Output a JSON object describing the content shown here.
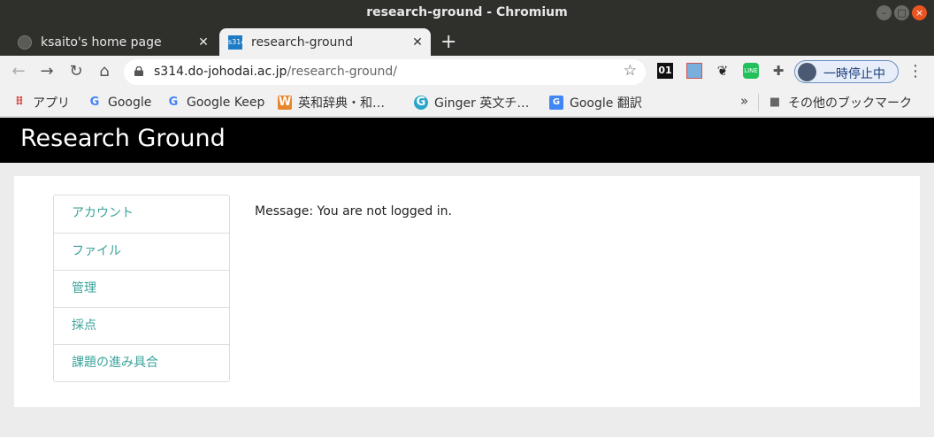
{
  "window": {
    "title": "research-ground - Chromium"
  },
  "tabs": [
    {
      "label": "ksaito's home page",
      "active": false
    },
    {
      "label": "research-ground",
      "active": true
    }
  ],
  "toolbar": {
    "url_host": "s314.do-johodai.ac.jp",
    "url_path": "/research-ground/",
    "profile_label": "一時停止中"
  },
  "bookmarks": [
    {
      "label": "アプリ",
      "icon": "apps-grid-icon"
    },
    {
      "label": "Google",
      "icon": "google-icon"
    },
    {
      "label": "Google Keep",
      "icon": "google-icon"
    },
    {
      "label": "英和辞典・和…",
      "icon": "weblio-icon"
    },
    {
      "label": "Ginger 英文チ…",
      "icon": "ginger-icon"
    },
    {
      "label": "Google 翻訳",
      "icon": "google-translate-icon"
    },
    {
      "label": "その他のブックマーク",
      "icon": "folder-icon"
    }
  ],
  "page": {
    "site_title": "Research Ground",
    "nav": [
      "アカウント",
      "ファイル",
      "管理",
      "採点",
      "課題の進み具合"
    ],
    "message": "Message: You are not logged in."
  }
}
